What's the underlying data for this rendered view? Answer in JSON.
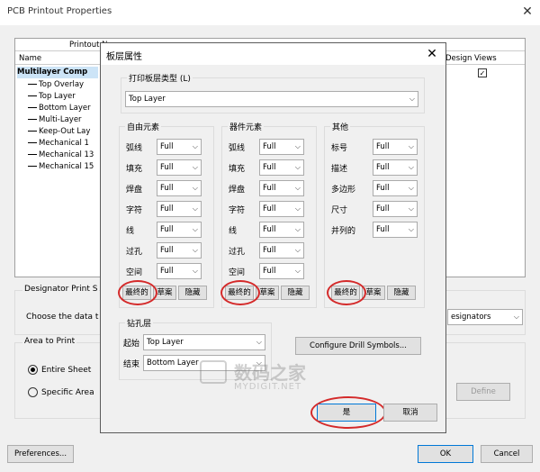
{
  "outer": {
    "title": "PCB Printout Properties",
    "close_glyph": "✕",
    "columns": {
      "printout": "Printout Na",
      "name": "Name",
      "design_views": "Design Views"
    },
    "tree": {
      "root": "Multilayer Comp",
      "items": [
        "Top Overlay",
        "Top Layer",
        "Bottom Layer",
        "Multi-Layer",
        "Keep-Out Lay",
        "Mechanical 1",
        "Mechanical 13",
        "Mechanical 15"
      ]
    },
    "designator_group": "Designator Print S",
    "designator_text": "Choose the data t",
    "designators_combo": "esignators",
    "area_group": "Area to Print",
    "entire_sheet": "Entire Sheet",
    "specific_area": "Specific Area",
    "define_button": "Define",
    "preferences_button": "Preferences...",
    "ok_button": "OK",
    "cancel_button": "Cancel"
  },
  "dialog": {
    "title": "板层属性",
    "close_glyph": "✕",
    "print_layer_type_label": "打印板层类型 (L)",
    "print_layer_type_value": "Top Layer",
    "free_group": "自由元素",
    "component_group": "器件元素",
    "other_group": "其他",
    "free_rows": [
      "弧线",
      "填充",
      "焊盘",
      "字符",
      "线",
      "过孔",
      "空间"
    ],
    "component_rows": [
      "弧线",
      "填充",
      "焊盘",
      "字符",
      "线",
      "过孔",
      "空间"
    ],
    "other_rows": [
      "标号",
      "描述",
      "多边形",
      "尺寸",
      "并列的"
    ],
    "full_value": "Full",
    "btn_final": "最终的",
    "btn_draft": "草案",
    "btn_hidden": "隐藏",
    "drill_group": "钻孔层",
    "drill_start_label": "起始",
    "drill_start_value": "Top Layer",
    "drill_end_label": "结束",
    "drill_end_value": "Bottom Layer",
    "configure_drill_button": "Configure Drill Symbols...",
    "yes_button": "是",
    "cancel_button": "取消"
  },
  "watermark": {
    "main": "数码之家",
    "sub": "MYDIGIT.NET"
  },
  "colors": {
    "highlight_circle": "#d42a2a",
    "accent": "#0078d7"
  }
}
